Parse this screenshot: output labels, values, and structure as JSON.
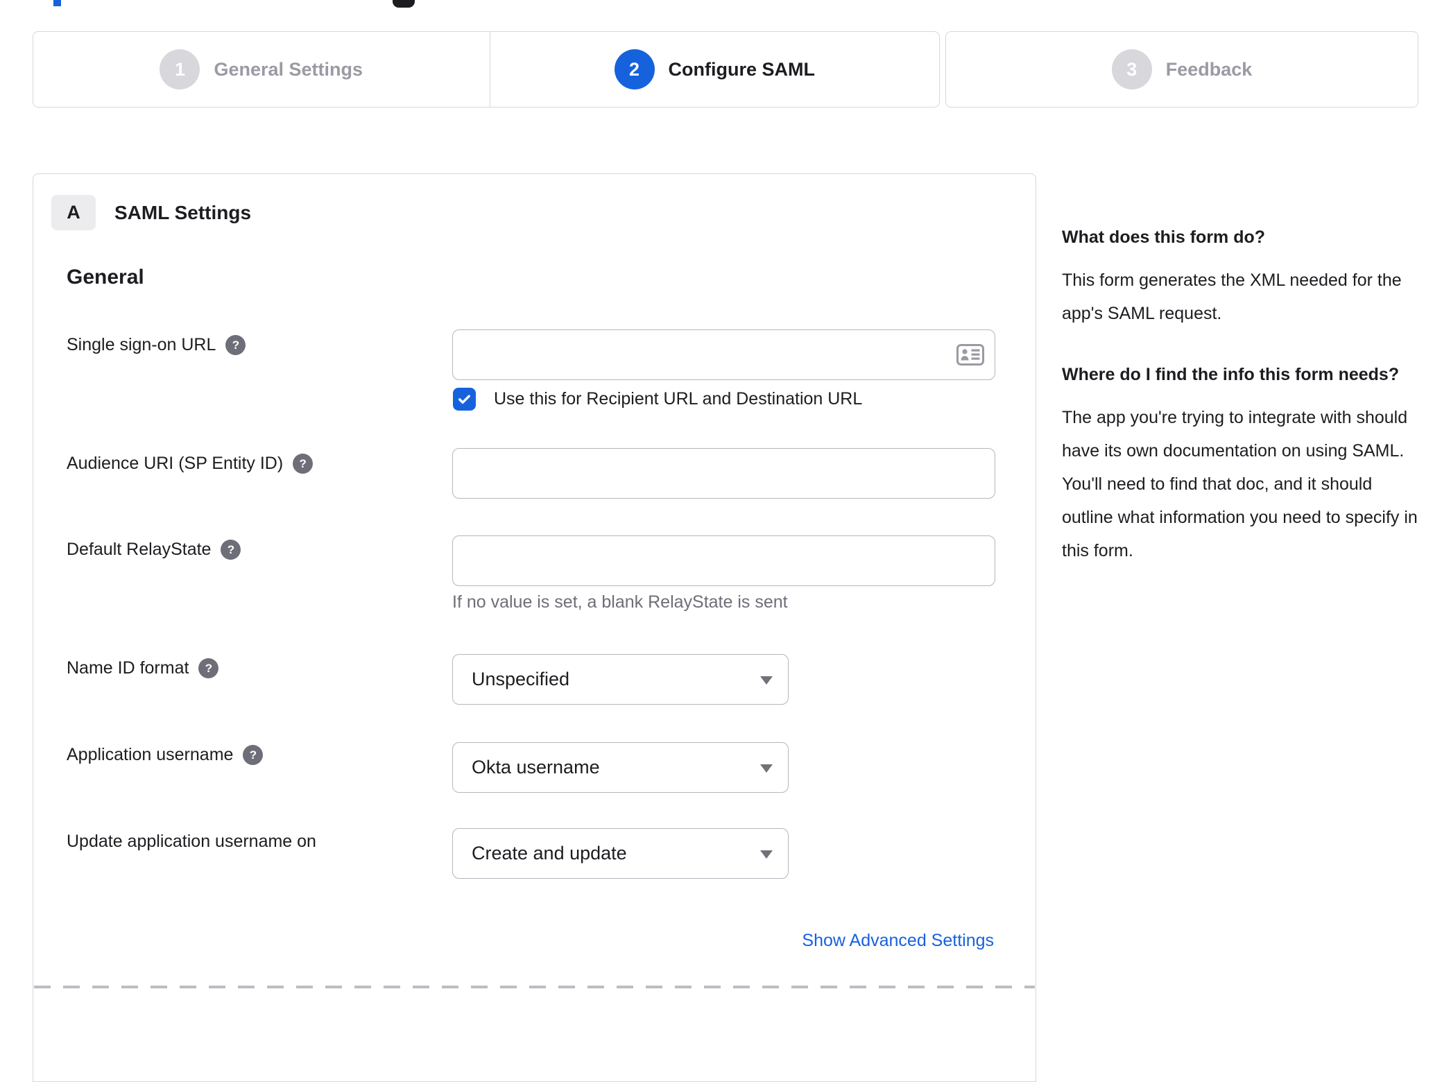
{
  "stepper": {
    "active_step": "2",
    "steps": [
      {
        "number": "1",
        "label": "General Settings"
      },
      {
        "number": "2",
        "label": "Configure SAML"
      },
      {
        "number": "3",
        "label": "Feedback"
      }
    ]
  },
  "card": {
    "badge": "A",
    "title": "SAML Settings",
    "section": "General",
    "fields": {
      "sso_url": {
        "label": "Single sign-on URL",
        "value": ""
      },
      "sso_checkbox": {
        "label": "Use this for Recipient URL and Destination URL",
        "checked": true
      },
      "audience_uri": {
        "label": "Audience URI (SP Entity ID)",
        "value": ""
      },
      "relay_state": {
        "label": "Default RelayState",
        "value": "",
        "helper": "If no value is set, a blank RelayState is sent"
      },
      "name_id_format": {
        "label": "Name ID format",
        "value": "Unspecified"
      },
      "app_username": {
        "label": "Application username",
        "value": "Okta username"
      },
      "update_username": {
        "label": "Update application username on",
        "value": "Create and update"
      }
    },
    "advanced_link": "Show Advanced Settings"
  },
  "sidebar": {
    "sections": [
      {
        "heading": "What does this form do?",
        "body": "This form generates the XML needed for the app's SAML request."
      },
      {
        "heading": "Where do I find the info this form needs?",
        "body": "The app you're trying to integrate with should have its own documentation on using SAML. You'll need to find that doc, and it should outline what information you need to specify in this form."
      }
    ]
  },
  "icons": {
    "help_glyph": "?",
    "checkbox_check": "check-mark",
    "dropdown_arrow": "triangle-down",
    "sso_input_icon": "contact-card"
  },
  "colors": {
    "accent_blue": "#1662dd",
    "border_light": "#d7d7dc",
    "border_input": "#b5b5bd",
    "text_dark": "#1d1d21",
    "text_gray": "#6e6e78",
    "inactive_gray": "#9a9aa3",
    "badge_bg": "#ececee"
  }
}
